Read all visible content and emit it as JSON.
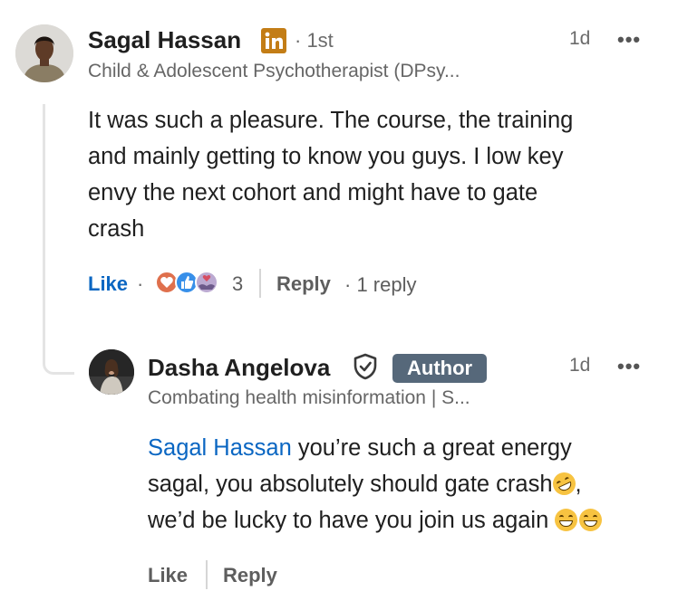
{
  "comment": {
    "author": "Sagal Hassan",
    "connection": "· 1st",
    "headline": "Child & Adolescent Psychotherapist (DPsy...",
    "time": "1d",
    "more": "•••",
    "text_lines": [
      "It was such a pleasure. The course, the training",
      "and mainly getting to know you guys. I low key",
      "envy the next cohort and might have to gate",
      "crash"
    ],
    "like_label": "Like",
    "reaction_count": "3",
    "reply_label": "Reply",
    "replies_label": "· 1 reply",
    "dot": "·"
  },
  "reply": {
    "author": "Dasha Angelova",
    "badge": "Author",
    "headline": "Combating health misinformation | S...",
    "time": "1d",
    "more": "•••",
    "mention": "Sagal Hassan",
    "line1_rest": " you’re such a great energy",
    "line2": "sagal, you absolutely should gate crash",
    "line2_end": ",",
    "line3": "we’d be lucky to have you join us again ",
    "like_label": "Like",
    "reply_label": "Reply"
  },
  "colors": {
    "link_blue": "#0a66c2",
    "linkedin_badge": "#c37d16",
    "author_badge": "#56687a"
  },
  "icons": [
    "linkedin-icon",
    "verified-shield-icon",
    "love-reaction-icon",
    "like-reaction-icon",
    "support-reaction-icon",
    "rofl-emoji",
    "grin-emoji"
  ]
}
